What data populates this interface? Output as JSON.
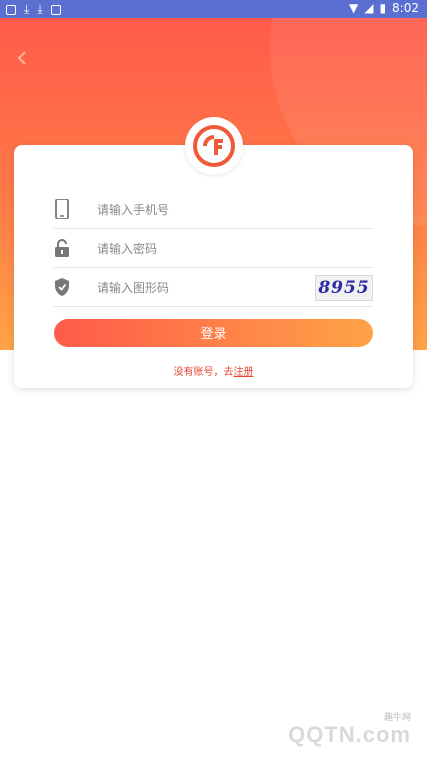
{
  "status_bar": {
    "time": "8:02"
  },
  "form": {
    "phone_placeholder": "请输入手机号",
    "password_placeholder": "请输入密码",
    "captcha_placeholder": "请输入图形码",
    "captcha_code": "8955",
    "login_label": "登录",
    "register_prefix": "没有账号，去",
    "register_link": "注册"
  },
  "watermark": {
    "site_cn": "趣牛网",
    "brand": "QQTN.com"
  },
  "colors": {
    "primary": "#ff5a4a",
    "secondary": "#ffa347",
    "statusbar": "#5b6fd0",
    "link": "#e8442e"
  }
}
